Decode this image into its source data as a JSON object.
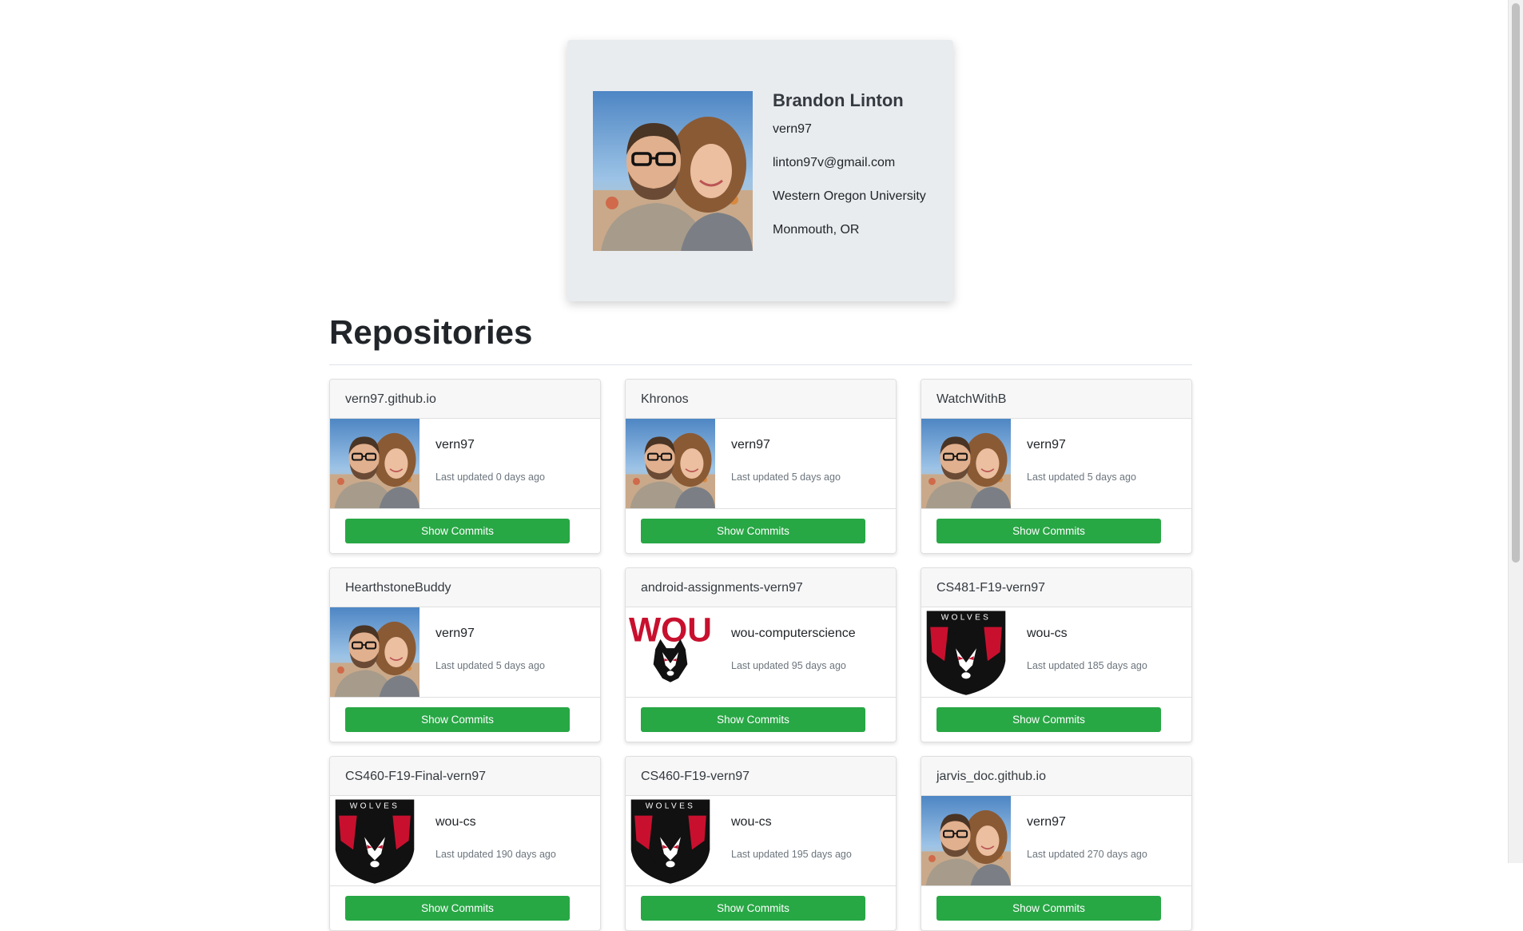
{
  "profile": {
    "name": "Brandon Linton",
    "username": "vern97",
    "email": "linton97v@gmail.com",
    "organization": "Western Oregon University",
    "location": "Monmouth, OR"
  },
  "repositories_heading": "Repositories",
  "button_label": "Show Commits",
  "repos": [
    {
      "name": "vern97.github.io",
      "owner": "vern97",
      "updated": "Last updated 0 days ago",
      "avatar": "photo"
    },
    {
      "name": "Khronos",
      "owner": "vern97",
      "updated": "Last updated 5 days ago",
      "avatar": "photo"
    },
    {
      "name": "WatchWithB",
      "owner": "vern97",
      "updated": "Last updated 5 days ago",
      "avatar": "photo"
    },
    {
      "name": "HearthstoneBuddy",
      "owner": "vern97",
      "updated": "Last updated 5 days ago",
      "avatar": "photo"
    },
    {
      "name": "android-assignments-vern97",
      "owner": "wou-computerscience",
      "updated": "Last updated 95 days ago",
      "avatar": "wou-logo"
    },
    {
      "name": "CS481-F19-vern97",
      "owner": "wou-cs",
      "updated": "Last updated 185 days ago",
      "avatar": "wolves-logo"
    },
    {
      "name": "CS460-F19-Final-vern97",
      "owner": "wou-cs",
      "updated": "Last updated 190 days ago",
      "avatar": "wolves-logo"
    },
    {
      "name": "CS460-F19-vern97",
      "owner": "wou-cs",
      "updated": "Last updated 195 days ago",
      "avatar": "wolves-logo"
    },
    {
      "name": "jarvis_doc.github.io",
      "owner": "vern97",
      "updated": "Last updated 270 days ago",
      "avatar": "photo"
    }
  ],
  "logo_text": {
    "wou": "WOU",
    "wolves": "WOLVES"
  },
  "colors": {
    "accent": "#28a745",
    "profile_bg": "#e9ecef",
    "wou_red": "#c8102e"
  }
}
